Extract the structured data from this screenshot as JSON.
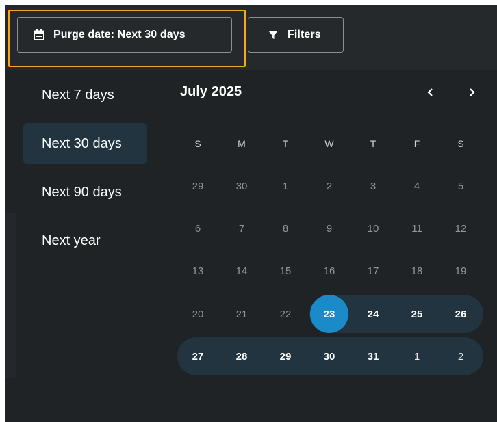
{
  "toolbar": {
    "date_button_label": "Purge date: Next 30 days",
    "date_icon": "calendar-icon",
    "filters_button_label": "Filters",
    "filters_icon": "filter-funnel-icon"
  },
  "presets": {
    "items": [
      {
        "label": "Next 7 days",
        "selected": false
      },
      {
        "label": "Next 30 days",
        "selected": true
      },
      {
        "label": "Next 90 days",
        "selected": false
      },
      {
        "label": "Next year",
        "selected": false
      }
    ]
  },
  "calendar": {
    "month_label": "July 2025",
    "prev_icon": "chevron-left-icon",
    "next_icon": "chevron-right-icon",
    "weekdays": [
      "S",
      "M",
      "T",
      "W",
      "T",
      "F",
      "S"
    ],
    "weeks": [
      [
        "29",
        "30",
        "1",
        "2",
        "3",
        "4",
        "5"
      ],
      [
        "6",
        "7",
        "8",
        "9",
        "10",
        "11",
        "12"
      ],
      [
        "13",
        "14",
        "15",
        "16",
        "17",
        "18",
        "19"
      ],
      [
        "20",
        "21",
        "22",
        "23",
        "24",
        "25",
        "26"
      ],
      [
        "27",
        "28",
        "29",
        "30",
        "31",
        "1",
        "2"
      ]
    ],
    "today": "23",
    "selected_range": "23 – 2"
  },
  "colors": {
    "accent": "#1b8ac9",
    "range_fill": "#21343f",
    "focus_outline": "#f5a623",
    "background": "#202326"
  }
}
